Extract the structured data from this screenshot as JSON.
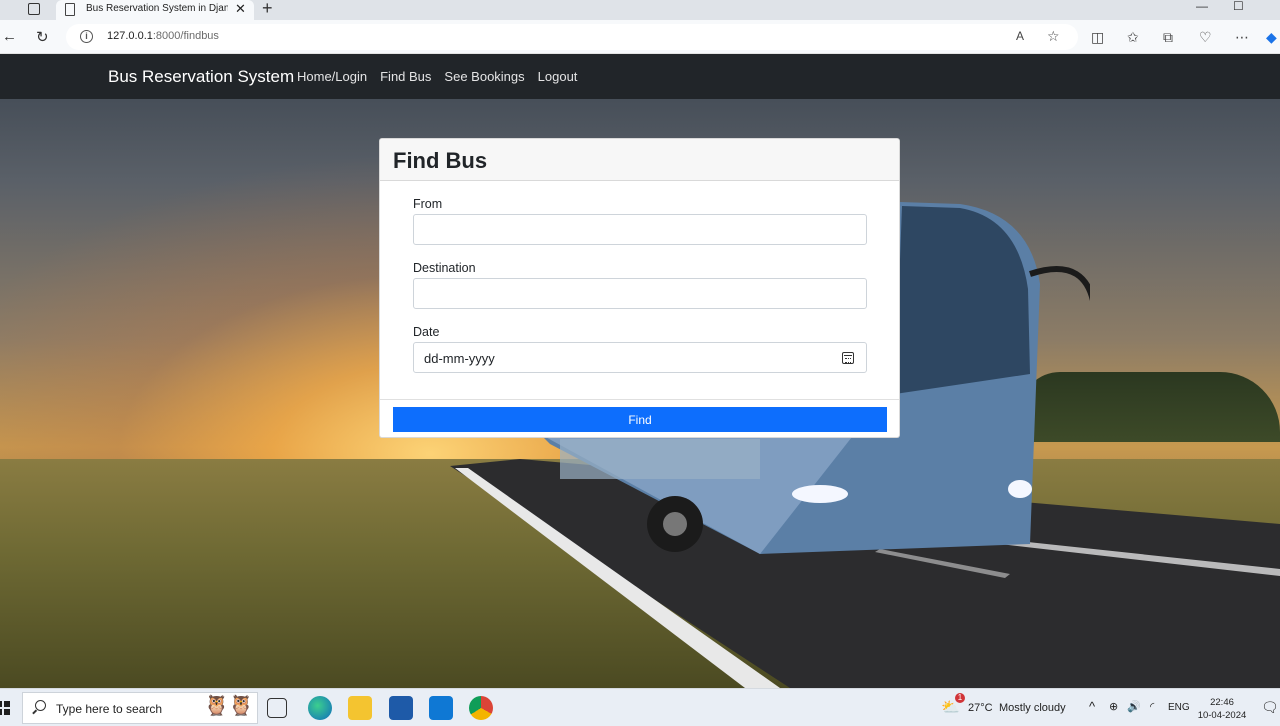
{
  "browser": {
    "tab_title": "Bus Reservation System in Djang",
    "url_host": "127.0.0.1",
    "url_rest": ":8000/findbus"
  },
  "navbar": {
    "brand": "Bus Reservation System",
    "links": [
      "Home/Login",
      "Find Bus",
      "See Bookings",
      "Logout"
    ]
  },
  "form": {
    "title": "Find Bus",
    "from_label": "From",
    "from_value": "",
    "destination_label": "Destination",
    "destination_value": "",
    "date_label": "Date",
    "date_placeholder": "dd-mm-yyyy",
    "submit_label": "Find"
  },
  "taskbar": {
    "search_placeholder": "Type here to search",
    "weather_temp": "27°C",
    "weather_text": "Mostly cloudy",
    "language": "ENG",
    "time": "22:46",
    "date": "10-04-2024",
    "weather_badge": "1"
  },
  "colors": {
    "navbar": "#212529",
    "primary_button": "#0d6efd",
    "card_header": "#f7f7f7"
  }
}
